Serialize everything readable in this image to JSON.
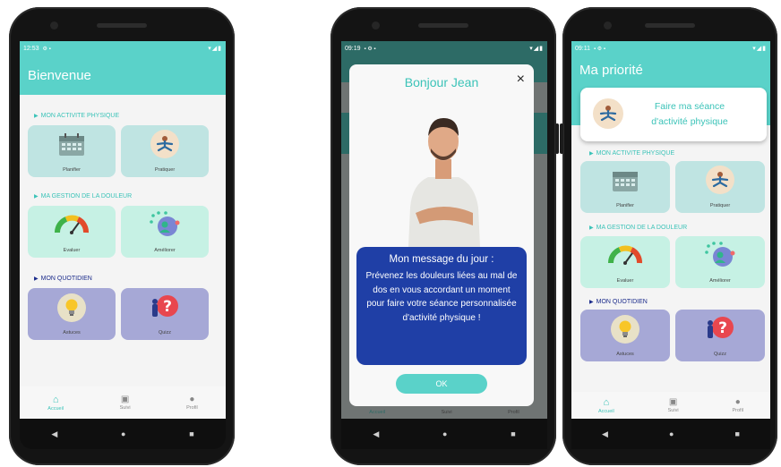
{
  "colors": {
    "accent": "#5ad2c9",
    "section_teal": "#3bc3b8",
    "section_navy": "#1a2a8a",
    "tile_teal": "#bfe4e2",
    "tile_mint": "#c6f1e4",
    "tile_purple": "#a6a8d6",
    "modal_blue": "#1f3fa6",
    "ok_button": "#5ad2c9"
  },
  "phone1": {
    "status_time": "12:53",
    "status_right": "▾◢▮",
    "title": "Bienvenue",
    "sections": [
      {
        "label": "MON ACTIVITE PHYSIQUE"
      },
      {
        "label": "MA GESTION DE LA DOULEUR"
      },
      {
        "label": "MON QUOTIDIEN"
      }
    ],
    "tiles": [
      {
        "label": "Planifier",
        "icon": "calendar-icon"
      },
      {
        "label": "Pratiquer",
        "icon": "yoga-icon"
      },
      {
        "label": "Evaluer",
        "icon": "gauge-icon"
      },
      {
        "label": "Améliorer",
        "icon": "improve-icon"
      },
      {
        "label": "Astuces",
        "icon": "lightbulb-icon"
      },
      {
        "label": "Quizz",
        "icon": "question-icon"
      }
    ],
    "nav": [
      {
        "label": "Accueil",
        "icon": "home-icon"
      },
      {
        "label": "Suivi",
        "icon": "chart-icon"
      },
      {
        "label": "Profil",
        "icon": "person-icon"
      }
    ]
  },
  "phone2": {
    "status_time": "09:19",
    "status_right": "▾◢▮",
    "modal_title": "Bonjour Jean",
    "close_label": "×",
    "message_title": "Mon message du jour :",
    "message_body": "Prévenez les douleurs liées au mal de dos en vous accordant un moment pour faire votre séance personnalisée d'activité physique !",
    "ok_label": "OK",
    "nav": [
      {
        "label": "Accueil"
      },
      {
        "label": "Suivi"
      },
      {
        "label": "Profil"
      }
    ]
  },
  "phone3": {
    "status_time": "09:11",
    "status_right": "▾◢▮",
    "title": "Ma priorité",
    "priority_text": "Faire ma séance d'activité physique",
    "sections": [
      {
        "label": "MON ACTIVITE PHYSIQUE"
      },
      {
        "label": "MA GESTION DE LA DOULEUR"
      },
      {
        "label": "MON QUOTIDIEN"
      }
    ],
    "tiles": [
      {
        "label": "Planifier"
      },
      {
        "label": "Pratiquer"
      },
      {
        "label": "Evaluer"
      },
      {
        "label": "Améliorer"
      },
      {
        "label": "Astuces"
      },
      {
        "label": "Quizz"
      }
    ],
    "nav": [
      {
        "label": "Accueil"
      },
      {
        "label": "Suivi"
      },
      {
        "label": "Profil"
      }
    ]
  },
  "sysnav": {
    "back": "◀",
    "home": "●",
    "recents": "■"
  }
}
